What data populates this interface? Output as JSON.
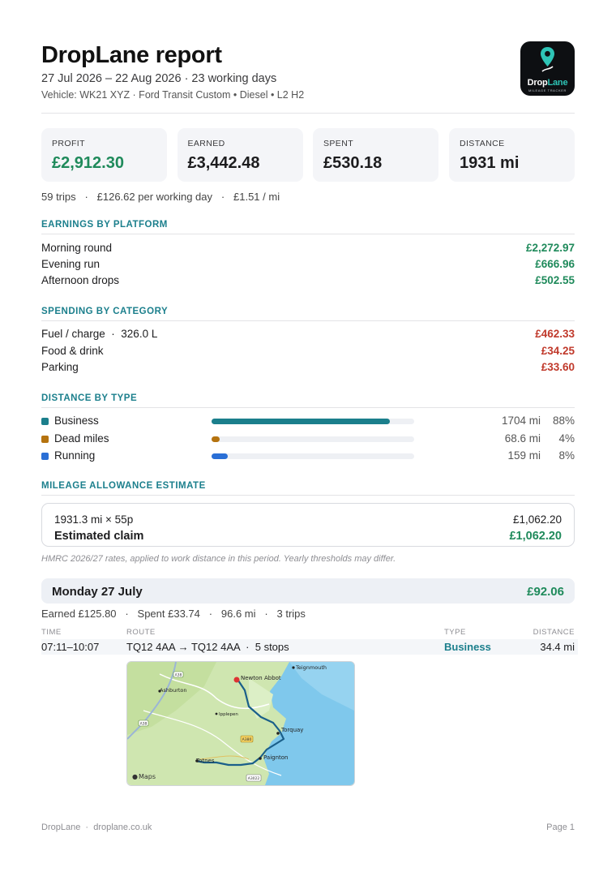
{
  "header": {
    "title": "DropLane report",
    "period": "27 Jul 2026 – 22 Aug 2026 · 23 working days",
    "vehicle": "Vehicle: WK21 XYZ · Ford Transit Custom • Diesel • L2 H2"
  },
  "logo": {
    "word_drop": "Drop",
    "word_lane": "Lane",
    "tagline": "MILEAGE TRACKER"
  },
  "cards": [
    {
      "label": "PROFIT",
      "value": "£2,912.30"
    },
    {
      "label": "EARNED",
      "value": "£3,442.48"
    },
    {
      "label": "SPENT",
      "value": "£530.18"
    },
    {
      "label": "DISTANCE",
      "value": "1931 mi"
    }
  ],
  "summary": "59 trips   ·   £126.62 per working day   ·   £1.51 / mi",
  "earnings": {
    "heading": "EARNINGS BY PLATFORM",
    "items": [
      {
        "label": "Morning round",
        "amount": "£2,272.97"
      },
      {
        "label": "Evening run",
        "amount": "£666.96"
      },
      {
        "label": "Afternoon drops",
        "amount": "£502.55"
      }
    ]
  },
  "spending": {
    "heading": "SPENDING BY CATEGORY",
    "items": [
      {
        "label": "Fuel / charge  ·  326.0 L",
        "amount": "£462.33"
      },
      {
        "label": "Food & drink",
        "amount": "£34.25"
      },
      {
        "label": "Parking",
        "amount": "£33.60"
      }
    ]
  },
  "distance": {
    "heading": "DISTANCE BY TYPE",
    "items": [
      {
        "label": "Business",
        "distance": "1704 mi",
        "percent": "88%",
        "share": 0.88,
        "color": "#1b7f8c"
      },
      {
        "label": "Dead miles",
        "distance": "68.6 mi",
        "percent": "4%",
        "share": 0.04,
        "color": "#b5730f"
      },
      {
        "label": "Running",
        "distance": "159 mi",
        "percent": "8%",
        "share": 0.08,
        "color": "#2a6fd6"
      }
    ]
  },
  "mileage": {
    "heading": "MILEAGE ALLOWANCE ESTIMATE",
    "calc": "1931.3 mi × 55p",
    "calc_amount": "£1,062.20",
    "claim_label": "Estimated claim",
    "claim_amount": "£1,062.20",
    "note": "HMRC 2026/27 rates, applied to work distance in this period. Yearly thresholds may differ."
  },
  "day": {
    "title": "Monday 27 July",
    "total": "£92.06",
    "summary": "Earned £125.80   ·   Spent £33.74   ·   96.6 mi   ·   3 trips",
    "columns": {
      "time": "TIME",
      "route": "ROUTE",
      "type": "TYPE",
      "distance": "DISTANCE"
    },
    "trip": {
      "time": "07:11–10:07",
      "route": "TQ12 4AA → TQ12 4AA  ·  5 stops",
      "type": "Business",
      "distance": "34.4 mi"
    }
  },
  "map": {
    "places": {
      "newton_abbot": "Newton Abbot",
      "teignmouth": "Teignmouth",
      "ashburton": "Ashburton",
      "ipplepen": "Ipplepen",
      "torquay": "Torquay",
      "paignton": "Paignton",
      "totnes": "Totnes"
    },
    "roads": {
      "a38_top": "A38",
      "a38_left": "A38",
      "a380": "A380",
      "a3022": "A3022"
    },
    "attribution": "Maps"
  },
  "footer": {
    "left": "DropLane  ·  droplane.co.uk",
    "right": "Page 1"
  }
}
